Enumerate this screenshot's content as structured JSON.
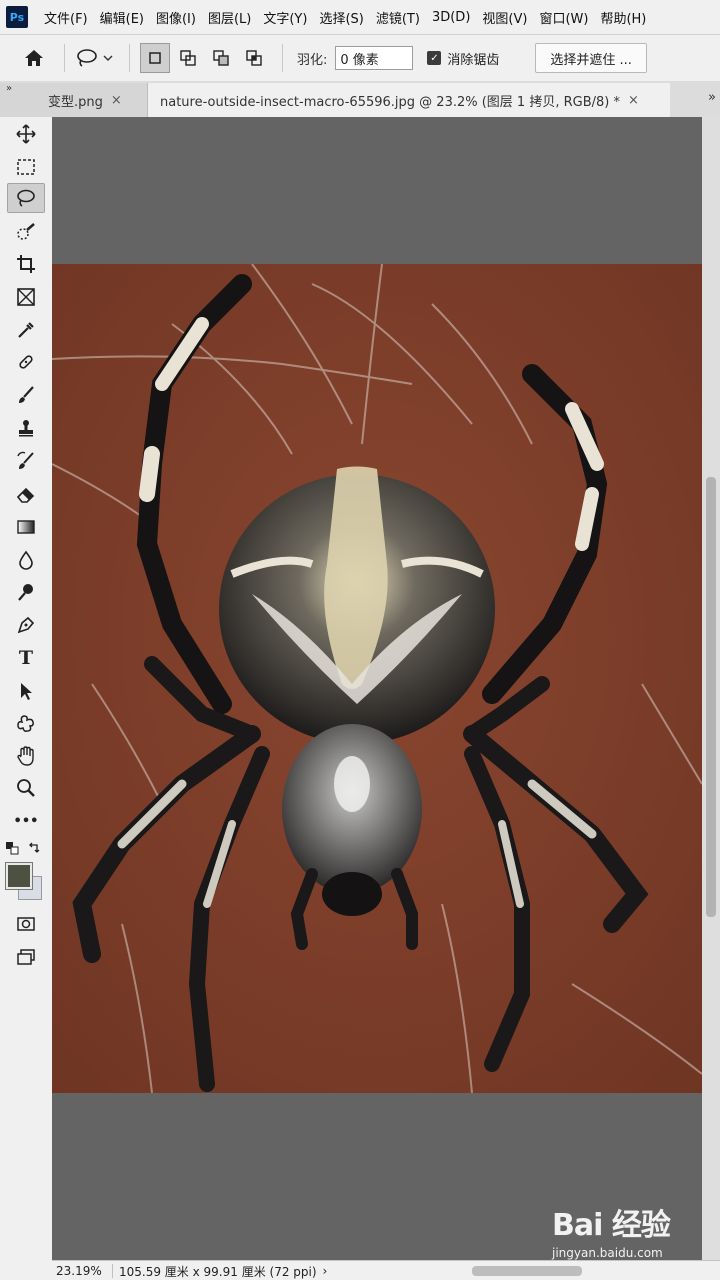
{
  "app": {
    "logo": "Ps"
  },
  "menubar": {
    "items": [
      "文件(F)",
      "编辑(E)",
      "图像(I)",
      "图层(L)",
      "文字(Y)",
      "选择(S)",
      "滤镜(T)",
      "3D(D)",
      "视图(V)",
      "窗口(W)",
      "帮助(H)"
    ]
  },
  "options": {
    "feather_label": "羽化:",
    "feather_value": "0 像素",
    "antialias_label": "消除锯齿",
    "antialias_checked": true,
    "select_mask_label": "选择并遮住 ..."
  },
  "tabs": {
    "collapse_glyph": "»",
    "inactive_label": "变型.png",
    "active_label": "nature-outside-insect-macro-65596.jpg @ 23.2% (图层 1 拷贝, RGB/8) *",
    "close_glyph": "×",
    "more_glyph": "»"
  },
  "toolbar": {
    "tools": [
      "move-icon",
      "marquee-icon",
      "lasso-icon",
      "quick-select-icon",
      "crop-icon",
      "frame-icon",
      "eyedropper-icon",
      "healing-icon",
      "brush-icon",
      "stamp-icon",
      "history-brush-icon",
      "eraser-icon",
      "gradient-icon",
      "blur-icon",
      "dodge-icon",
      "pen-icon",
      "type-icon",
      "path-select-icon",
      "shape-icon",
      "hand-icon",
      "zoom-icon",
      "more-icon"
    ],
    "type_glyph": "T",
    "more_glyph": "•••"
  },
  "colors": {
    "foreground": "#4d5142",
    "background": "#d8dde6",
    "image_bg": "#7a3d27"
  },
  "status": {
    "zoom": "23.19%",
    "doc_info": "105.59 厘米 x 99.91 厘米 (72 ppi)",
    "arrow": "›"
  },
  "watermark": {
    "logo": "Bai 经验",
    "url": "jingyan.baidu.com"
  }
}
